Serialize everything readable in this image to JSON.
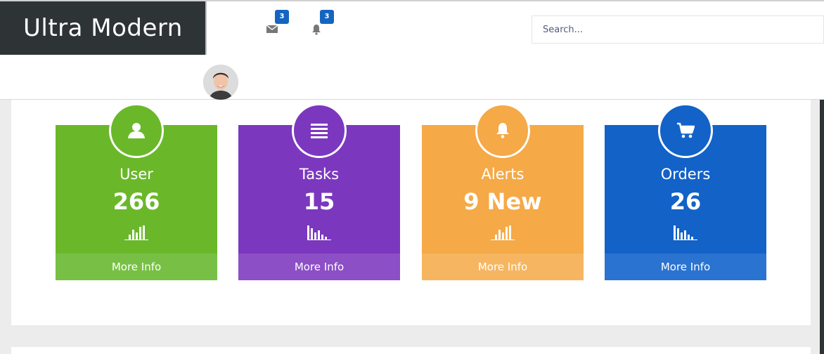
{
  "header": {
    "brand": "Ultra Modern",
    "messages": {
      "icon": "envelope-icon",
      "count": "3"
    },
    "notifications": {
      "icon": "bell-icon",
      "count": "3"
    },
    "search": {
      "placeholder": "Search..."
    },
    "avatar": {
      "icon": "user-avatar"
    }
  },
  "cards": [
    {
      "title": "User",
      "value": "266",
      "icon": "user-icon",
      "spark": "bars-up-icon",
      "more": "More Info",
      "color": "#6ab82a"
    },
    {
      "title": "Tasks",
      "value": "15",
      "icon": "list-icon",
      "spark": "bars-down-icon",
      "more": "More Info",
      "color": "#7b38be"
    },
    {
      "title": "Alerts",
      "value": "9 New",
      "icon": "bell-icon",
      "spark": "bars-up-icon",
      "more": "More Info",
      "color": "#f5a947"
    },
    {
      "title": "Orders",
      "value": "26",
      "icon": "cart-icon",
      "spark": "bars-down-icon",
      "more": "More Info",
      "color": "#1262c8"
    }
  ]
}
